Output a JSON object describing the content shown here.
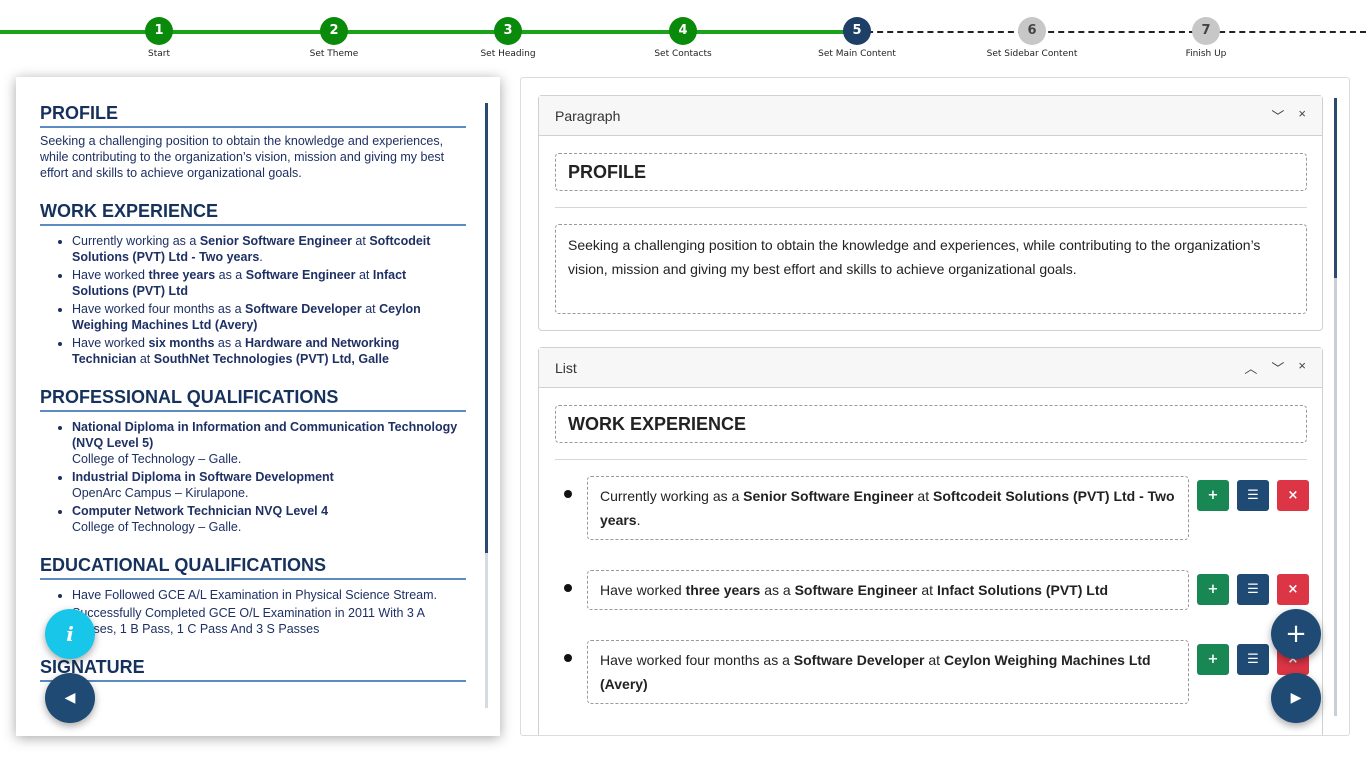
{
  "stepper": {
    "steps": [
      {
        "number": "1",
        "label": "Start",
        "state": "done"
      },
      {
        "number": "2",
        "label": "Set Theme",
        "state": "done"
      },
      {
        "number": "3",
        "label": "Set Heading",
        "state": "done"
      },
      {
        "number": "4",
        "label": "Set Contacts",
        "state": "done"
      },
      {
        "number": "5",
        "label": "Set Main Content",
        "state": "active"
      },
      {
        "number": "6",
        "label": "Set Sidebar Content",
        "state": "todo"
      },
      {
        "number": "7",
        "label": "Finish Up",
        "state": "todo"
      }
    ],
    "colors": {
      "done": "#0a8a0a",
      "active": "#1e3f66",
      "todo": "#c7c7c7"
    }
  },
  "preview": {
    "profile": {
      "heading": "PROFILE",
      "text": "Seeking a challenging position to obtain the knowledge and experiences, while contributing to the organization’s vision, mission and giving my best effort and skills to achieve organizational goals."
    },
    "work": {
      "heading": "WORK EXPERIENCE",
      "items": [
        [
          {
            "t": "Currently working as a "
          },
          {
            "t": "Senior Software Engineer",
            "b": true
          },
          {
            "t": " at "
          },
          {
            "t": "Softcodeit Solutions (PVT) Ltd - Two years",
            "b": true
          },
          {
            "t": "."
          }
        ],
        [
          {
            "t": "Have worked "
          },
          {
            "t": "three years",
            "b": true
          },
          {
            "t": " as a "
          },
          {
            "t": "Software Engineer",
            "b": true
          },
          {
            "t": " at "
          },
          {
            "t": "Infact Solutions (PVT) Ltd",
            "b": true
          }
        ],
        [
          {
            "t": "Have worked four months as a "
          },
          {
            "t": "Software Developer",
            "b": true
          },
          {
            "t": " at "
          },
          {
            "t": "Ceylon Weighing Machines Ltd (Avery)",
            "b": true
          }
        ],
        [
          {
            "t": "Have worked "
          },
          {
            "t": "six months",
            "b": true
          },
          {
            "t": " as a "
          },
          {
            "t": "Hardware and Networking Technician",
            "b": true
          },
          {
            "t": " at "
          },
          {
            "t": "SouthNet Technologies (PVT) Ltd, Galle",
            "b": true
          }
        ]
      ]
    },
    "professional": {
      "heading": "PROFESSIONAL QUALIFICATIONS",
      "items": [
        {
          "title": "National Diploma in Information and Communication Technology (NVQ Level 5)",
          "sub": "College of Technology – Galle."
        },
        {
          "title": "Industrial Diploma in Software Development",
          "sub": "OpenArc Campus – Kirulapone."
        },
        {
          "title": "Computer Network Technician NVQ Level 4",
          "sub": "College of Technology – Galle."
        }
      ]
    },
    "educational": {
      "heading": "EDUCATIONAL QUALIFICATIONS",
      "items": [
        "Have Followed GCE A/L Examination in Physical Science Stream.",
        "Successfully Completed GCE O/L Examination in 2011 With 3 A Passes, 1 B Pass, 1 C Pass And 3 S Passes"
      ]
    },
    "signature": {
      "heading": "SIGNATURE"
    }
  },
  "editor": {
    "paragraph_card": {
      "title": "Paragraph",
      "heading_value": "PROFILE",
      "text_value": "Seeking a challenging position to obtain the knowledge and experiences, while contributing to the organization’s vision, mission and giving my best effort and skills to achieve organizational goals."
    },
    "list_card": {
      "title": "List",
      "heading_value": "WORK EXPERIENCE",
      "items": [
        [
          {
            "t": "Currently working as a "
          },
          {
            "t": "Senior Software Engineer",
            "b": true
          },
          {
            "t": " at "
          },
          {
            "t": "Softcodeit Solutions (PVT) Ltd - Two years",
            "b": true
          },
          {
            "t": "."
          }
        ],
        [
          {
            "t": "Have worked "
          },
          {
            "t": "three years",
            "b": true
          },
          {
            "t": " as a "
          },
          {
            "t": "Software Engineer",
            "b": true
          },
          {
            "t": " at "
          },
          {
            "t": "Infact Solutions (PVT) Ltd",
            "b": true
          }
        ],
        [
          {
            "t": "Have worked four months as a "
          },
          {
            "t": "Software Developer",
            "b": true
          },
          {
            "t": " at "
          },
          {
            "t": "Ceylon Weighing Machines Ltd (Avery)",
            "b": true
          }
        ]
      ]
    },
    "controls": {
      "collapse": "﹀",
      "expand": "︿",
      "close": "×",
      "add": "+",
      "format": "☰",
      "remove": "×"
    },
    "item_button_icons": [
      "plus-icon",
      "list-icon",
      "close-icon"
    ]
  },
  "fabs": {
    "info": "i",
    "add": "+",
    "prev": "◀",
    "next": "▶",
    "icons": {
      "info": "info-icon",
      "add": "plus-icon",
      "prev": "triangle-left-icon",
      "next": "triangle-right-icon"
    }
  },
  "theme": {
    "green": "#1aa31a",
    "navy": "#1e4a74",
    "cyan": "#18c6ea",
    "red": "#dc3545",
    "success": "#198754"
  }
}
